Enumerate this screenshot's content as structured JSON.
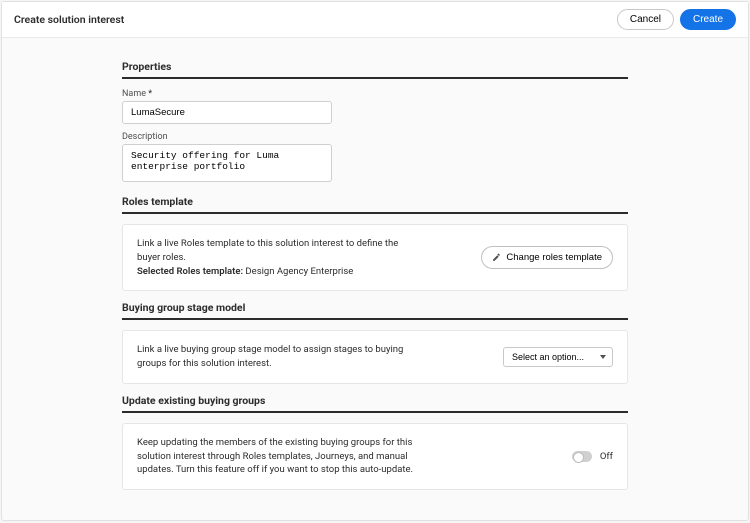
{
  "header": {
    "title": "Create solution interest",
    "cancel": "Cancel",
    "create": "Create"
  },
  "properties": {
    "section": "Properties",
    "name_label": "Name",
    "name_value": "LumaSecure",
    "desc_label": "Description",
    "desc_value": "Security offering for Luma enterprise portfolio"
  },
  "roles": {
    "section": "Roles template",
    "desc": "Link a live Roles template to this solution interest to define the buyer roles.",
    "selected_label": "Selected Roles template:",
    "selected_value": "Design Agency Enterprise",
    "button": "Change roles template"
  },
  "stage": {
    "section": "Buying group stage model",
    "desc": "Link a live buying group stage model to assign stages to buying groups for this solution interest.",
    "placeholder": "Select an option..."
  },
  "update": {
    "section": "Update existing buying groups",
    "desc": "Keep updating the members of the existing buying groups for this solution interest through Roles templates, Journeys, and manual updates. Turn this feature off if you want to stop this auto-update.",
    "state": "Off"
  }
}
